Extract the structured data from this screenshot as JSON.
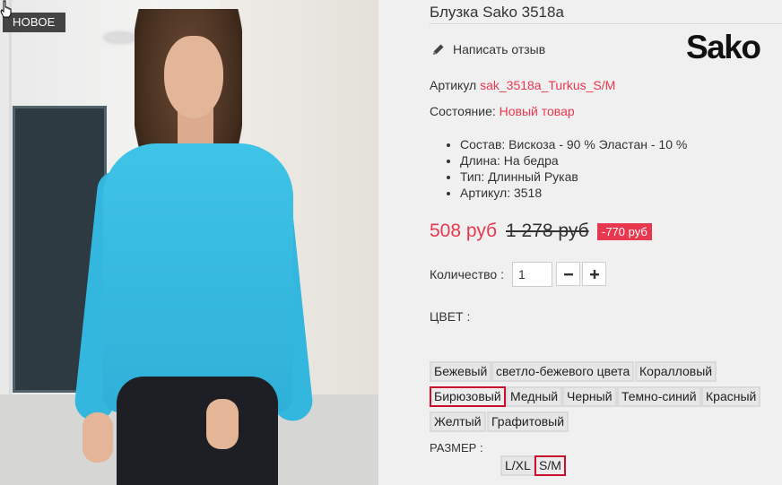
{
  "badge": {
    "label": "НОВОЕ"
  },
  "product": {
    "title": "Блузка Sako 3518a",
    "review_label": "Написать отзыв",
    "brand": "Sako",
    "sku_label": "Артикул",
    "sku_value": "sak_3518a_Turkus_S/M",
    "condition_label": "Состояние:",
    "condition_value": "Новый товар",
    "features": [
      "Состав: Вискоза - 90 % Эластан - 10 %",
      "Длина: На бедра",
      "Тип: Длинный Рукав",
      "Артикул: 3518"
    ]
  },
  "pricing": {
    "price": "508 руб",
    "old_price": "1 278 руб",
    "discount": "-770 руб"
  },
  "quantity": {
    "label": "Количество :",
    "value": "1",
    "minus": "−",
    "plus": "+"
  },
  "colors": {
    "label": "ЦВЕТ :",
    "options": [
      "Бежевый",
      "светло-бежевого цвета",
      "Коралловый",
      "Бирюзовый",
      "Медный",
      "Черный",
      "Темно-синий",
      "Красный",
      "Желтый",
      "Графитовый"
    ],
    "selected": "Бирюзовый"
  },
  "sizes": {
    "label": "РАЗМЕР :",
    "options": [
      "L/XL",
      "S/M"
    ],
    "selected": "S/M"
  },
  "accent_color": "#e8384f",
  "selected_border_color": "#c8102e"
}
